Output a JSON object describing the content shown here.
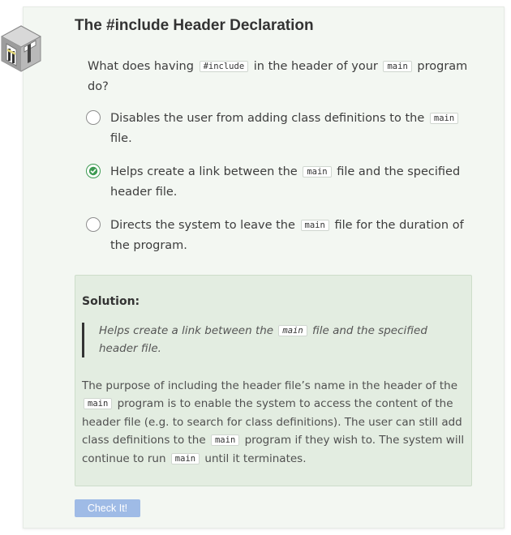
{
  "header": {
    "title": "The #include Header Declaration",
    "icon": "cube-icon"
  },
  "question": {
    "prefix": "What does having",
    "code1": "#include",
    "middle": "in the header of your",
    "code2": "main",
    "suffix": "program do?"
  },
  "options": [
    {
      "pre": "Disables the user from adding class definitions to the",
      "code": "main",
      "post": "file.",
      "selected": false
    },
    {
      "pre": "Helps create a link between the",
      "code": "main",
      "post": "file and the specified header file.",
      "selected": true
    },
    {
      "pre": "Directs the system to leave the",
      "code": "main",
      "post": "file for the duration of the program.",
      "selected": false
    }
  ],
  "solution": {
    "label": "Solution:",
    "quote_pre": "Helps create a link between the",
    "quote_code": "main",
    "quote_post": "file and the specified header file.",
    "explain_1": "The purpose of including the header file’s name in the header of the",
    "explain_code1": "main",
    "explain_2": "program is to enable the system to access the content of the header file (e.g. to search for class definitions). The user can still add class definitions to the",
    "explain_code2": "main",
    "explain_3": "program if they wish to. The system will continue to run",
    "explain_code3": "main",
    "explain_4": "until it terminates."
  },
  "check_button": {
    "label": "Check It!"
  },
  "colors": {
    "card": "#f3f7f2",
    "solution": "#e3ede1",
    "selected": "#3d9a52",
    "button": "#9fbbe6"
  }
}
